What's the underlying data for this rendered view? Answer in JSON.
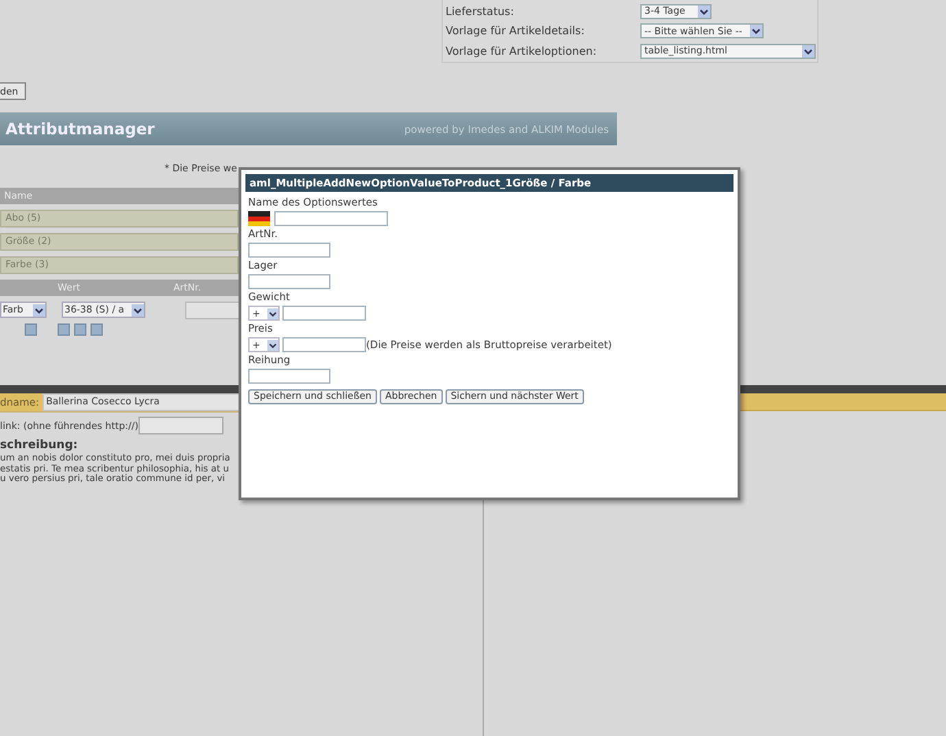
{
  "settings": [
    {
      "label": "Lieferstatus:",
      "value": "3-4 Tage"
    },
    {
      "label": "Vorlage für Artikeldetails:",
      "value": "-- Bitte wählen Sie --"
    },
    {
      "label": "Vorlage für Artikeloptionen:",
      "value": "table_listing.html"
    }
  ],
  "partial_button": "den",
  "header": {
    "title": "Attributmanager",
    "credit": "powered by Imedes and ALKIM Modules"
  },
  "price_note": "* Die Preise we",
  "table": {
    "header": "Name",
    "rows": [
      "Abo (5)",
      "Größe (2)",
      "Farbe (3)"
    ]
  },
  "value_table": {
    "columns": [
      "Wert",
      "ArtNr."
    ],
    "option_select": "Farb",
    "value_select": "36-38 (S) / a"
  },
  "product": {
    "name_label": "dname:",
    "name_value": "Ballerina Cosecco Lycra",
    "link_label": "link: (ohne führendes http://)",
    "desc_label": "schreibung:",
    "desc_lines": [
      "um an nobis dolor constituto pro, mei duis propria",
      "estatis pri. Te mea scribentur philosophia, his at u",
      "u vero persius pri, tale oratio commune id per, vi"
    ]
  },
  "dialog": {
    "title": "aml_MultipleAddNewOptionValueToProduct_1Größe / Farbe",
    "fields": [
      {
        "kind": "flag",
        "label": "Name des Optionswertes"
      },
      {
        "kind": "text",
        "label": "ArtNr."
      },
      {
        "kind": "text",
        "label": "Lager"
      },
      {
        "kind": "sign",
        "label": "Gewicht",
        "sign": "+"
      },
      {
        "kind": "sign",
        "label": "Preis",
        "sign": "+",
        "note": "(Die Preise werden als Bruttopreise verarbeitet)"
      },
      {
        "kind": "text",
        "label": "Reihung"
      }
    ],
    "buttons": [
      "Speichern und schließen",
      "Abbrechen",
      "Sichern und nächster Wert"
    ]
  }
}
